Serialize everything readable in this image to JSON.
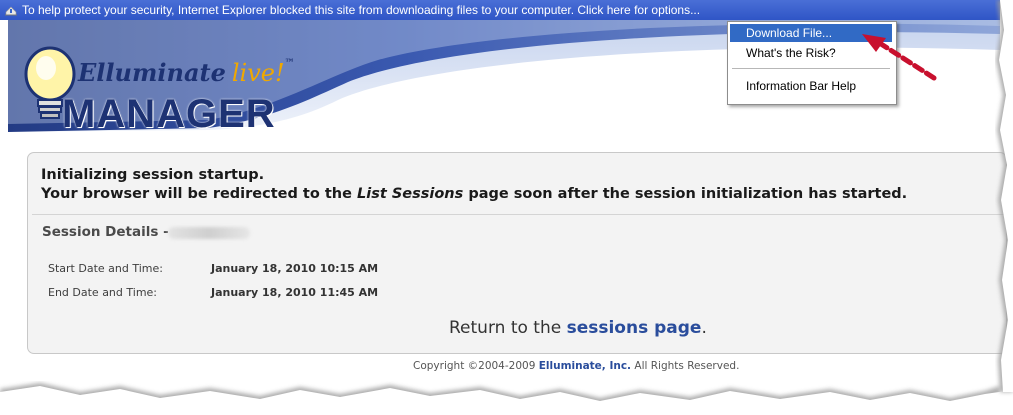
{
  "infobar": {
    "message": "To help protect your security, Internet Explorer blocked this site from downloading files to your computer. Click here for options...",
    "icon": "shield-icon"
  },
  "context_menu": {
    "items": [
      "Download File...",
      "What's the Risk?",
      "Information Bar Help"
    ],
    "selected": "Download File..."
  },
  "logo": {
    "brand": "Elluminate",
    "live": "live!",
    "tm": "™",
    "product": "MANAGER"
  },
  "content": {
    "status_line1": "Initializing session startup.",
    "status_line2_pre": "Your browser will be redirected to the ",
    "status_line2_em": "List Sessions",
    "status_line2_post": " page soon after the session initialization has started.",
    "details_label": "Session Details -",
    "start_label": "Start Date and Time:",
    "start_value": "January 18, 2010 10:15 AM",
    "end_label": "End Date and Time:",
    "end_value": "January 18, 2010 11:45 AM",
    "return_pre": "Return to the ",
    "return_link": "sessions page",
    "return_post": "."
  },
  "footer": {
    "copyright_pre": "Copyright ©2004-2009 ",
    "company": "Elluminate, Inc.",
    "copyright_post": " All Rights Reserved."
  },
  "colors": {
    "infobar": "#2f55c6",
    "menu_highlight": "#316ac5",
    "brand_navy": "#1d3273",
    "link_blue": "#2a4d9c",
    "arrow_red": "#c8102e"
  }
}
